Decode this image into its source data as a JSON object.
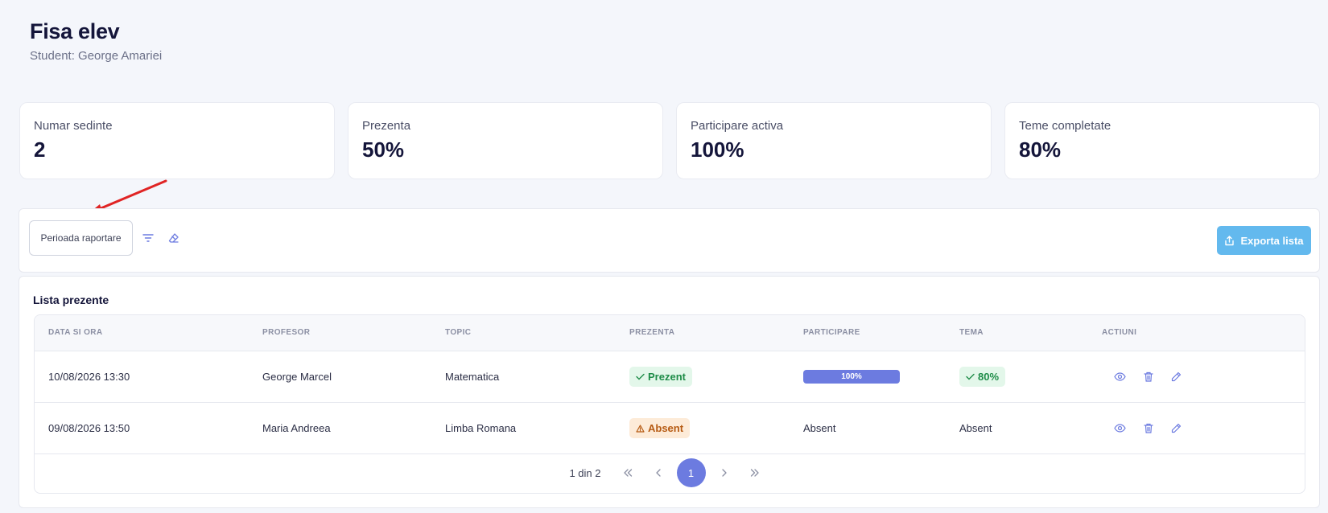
{
  "header": {
    "title": "Fisa elev",
    "subtitle": "Student: George Amariei"
  },
  "stats": [
    {
      "label": "Numar sedinte",
      "value": "2"
    },
    {
      "label": "Prezenta",
      "value": "50%"
    },
    {
      "label": "Participare activa",
      "value": "100%"
    },
    {
      "label": "Teme completate",
      "value": "80%"
    }
  ],
  "filters": {
    "period_label": "Perioada raportare",
    "filter_icon": "filter-lines-icon",
    "clear_icon": "eraser-icon",
    "export_label": "Exporta lista",
    "export_icon": "share-upload-icon"
  },
  "annotation": {
    "arrow_color": "#e02424",
    "icon": "red-arrow-icon"
  },
  "list": {
    "title": "Lista prezente",
    "columns": [
      "Data si ora",
      "Profesor",
      "Topic",
      "Prezenta",
      "Participare",
      "Tema",
      "Actiuni"
    ],
    "rows": [
      {
        "datetime": "10/08/2026 13:30",
        "teacher": "George Marcel",
        "topic": "Matematica",
        "attendance": "Prezent",
        "participation_percent": 100,
        "participation_label": "100%",
        "homework": "80%"
      },
      {
        "datetime": "09/08/2026 13:50",
        "teacher": "Maria Andreea",
        "topic": "Limba Romana",
        "attendance": "Absent",
        "participation_label": "Absent",
        "homework": "Absent"
      }
    ],
    "action_icons": [
      "eye-icon",
      "trash-icon",
      "pencil-icon"
    ]
  },
  "pagination": {
    "info": "1 din 2",
    "current_page": "1"
  },
  "colors": {
    "accent": "#6c7be0",
    "export_button": "#63b9ee",
    "success_bg": "#e3f7ea",
    "success_text": "#1e8c48",
    "warning_bg": "#fdebd8",
    "warning_text": "#b65a12"
  }
}
